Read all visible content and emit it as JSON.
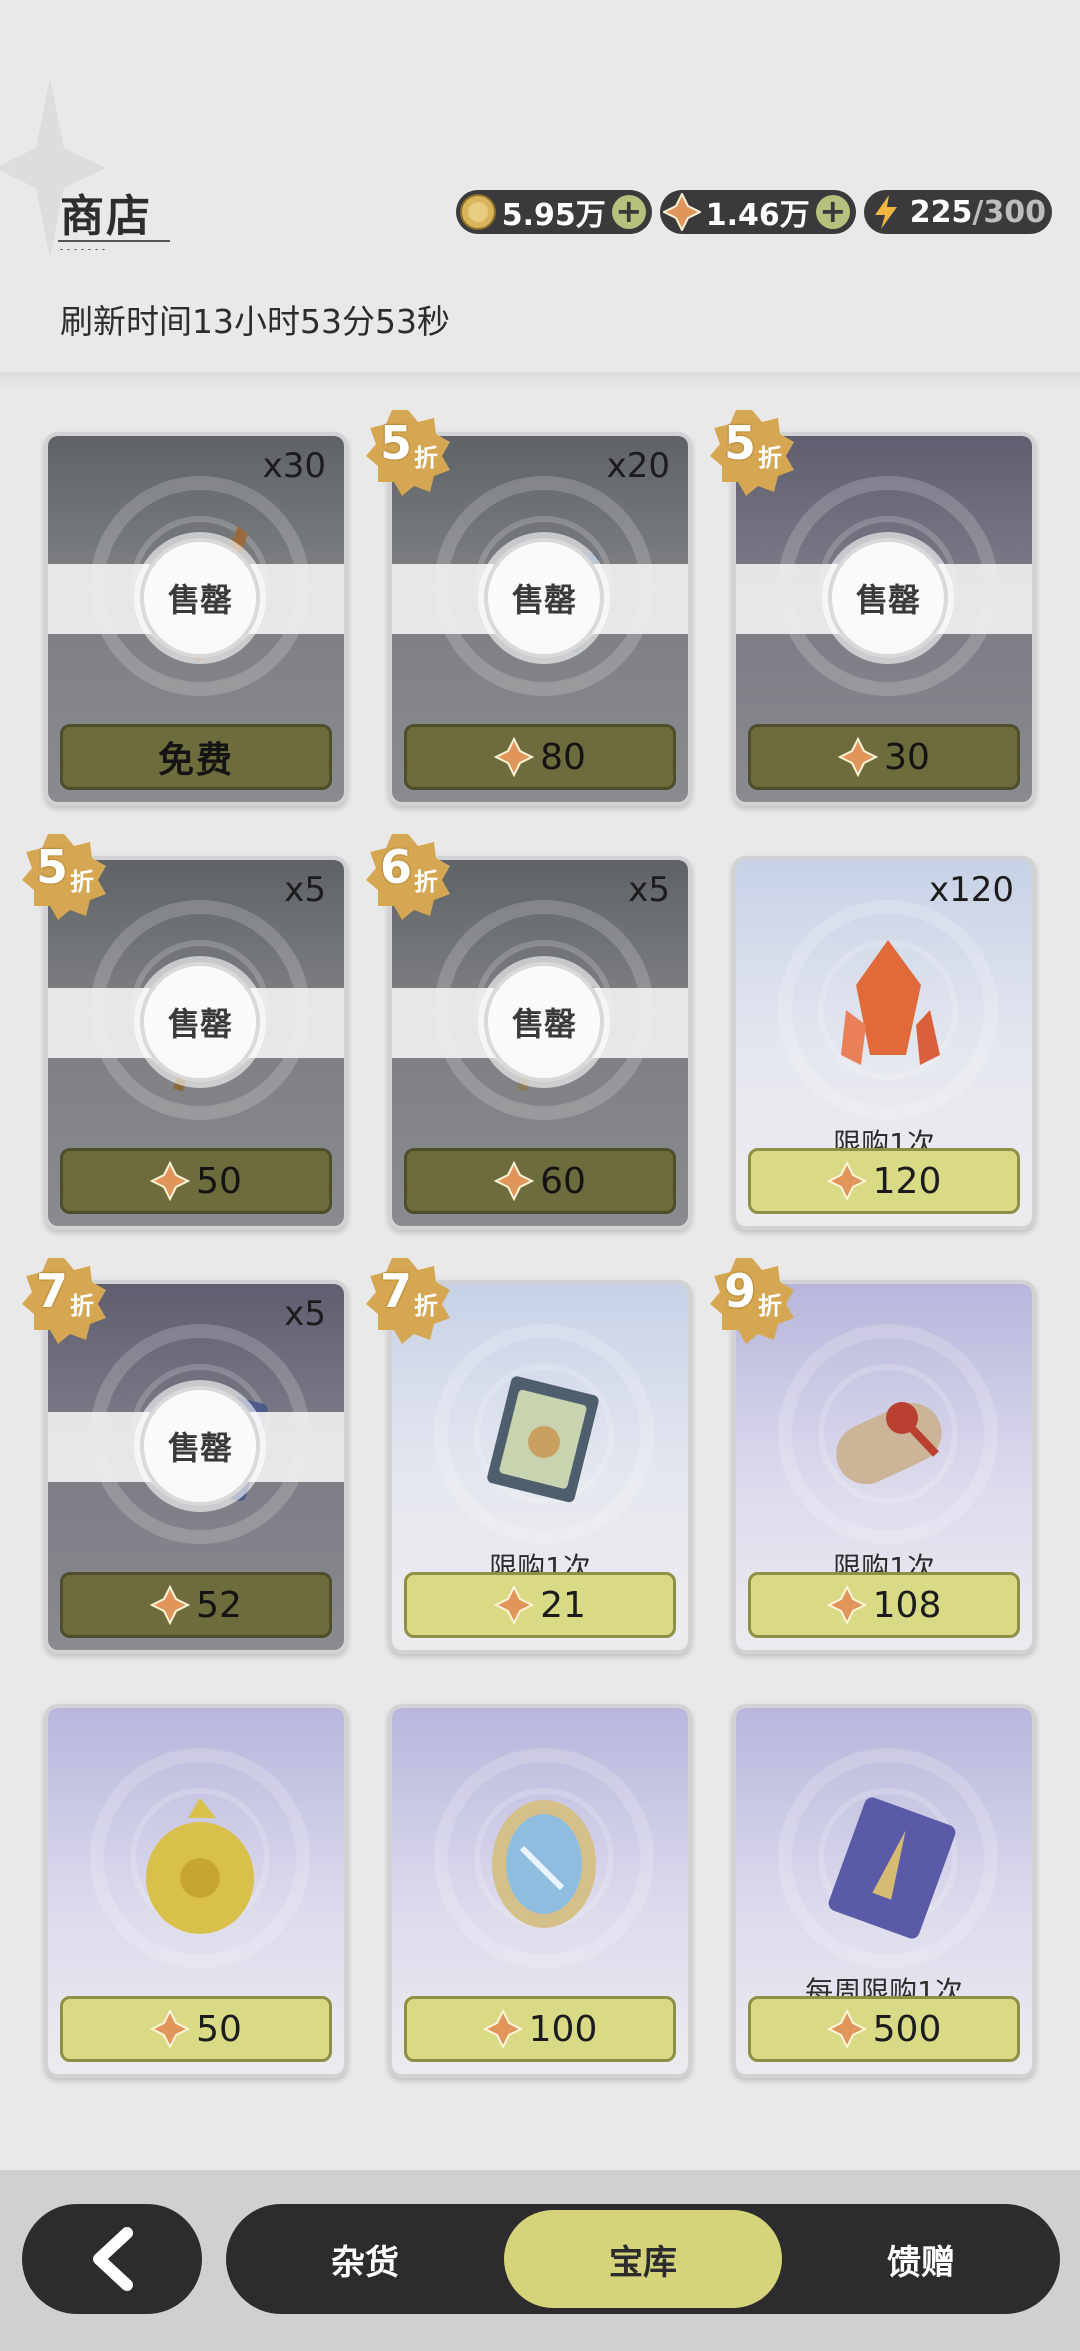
{
  "header": {
    "title": "商店",
    "refresh_text": "刷新时间13小时53分53秒"
  },
  "currencies": [
    {
      "icon": "gold-coin-icon",
      "value": "5.95万",
      "has_plus": true
    },
    {
      "icon": "crystal-icon",
      "value": "1.46万",
      "has_plus": true
    },
    {
      "icon": "lightning-icon",
      "value": "225",
      "max": "/300",
      "has_plus": false
    }
  ],
  "sold_label": "售罄",
  "discount_suffix": "折",
  "items": [
    {
      "state": "sold",
      "tone": "gray",
      "qty": "x30",
      "discount": "",
      "price": "免费",
      "free": true,
      "limit": "",
      "art": "dagger-icon"
    },
    {
      "state": "sold",
      "tone": "gray",
      "qty": "x20",
      "discount": "5",
      "price": "80",
      "free": false,
      "limit": "",
      "art": "book-icon"
    },
    {
      "state": "sold",
      "tone": "purple",
      "qty": "",
      "discount": "5",
      "price": "30",
      "free": false,
      "limit": "",
      "art": "bag-icon"
    },
    {
      "state": "sold",
      "tone": "gray",
      "qty": "x5",
      "discount": "5",
      "price": "50",
      "free": false,
      "limit": "",
      "art": "axe-icon"
    },
    {
      "state": "sold",
      "tone": "gray",
      "qty": "x5",
      "discount": "6",
      "price": "60",
      "free": false,
      "limit": "",
      "art": "pickaxe-icon"
    },
    {
      "state": "avail",
      "tone": "blue",
      "qty": "x120",
      "discount": "",
      "price": "120",
      "free": false,
      "limit": "限购1次",
      "art": "red-crystal-icon"
    },
    {
      "state": "sold",
      "tone": "purple",
      "qty": "x5",
      "discount": "7",
      "price": "52",
      "free": false,
      "limit": "",
      "art": "card-icon"
    },
    {
      "state": "avail",
      "tone": "blue",
      "qty": "",
      "discount": "7",
      "price": "21",
      "free": false,
      "limit": "限购1次",
      "art": "recipe-book-icon"
    },
    {
      "state": "avail",
      "tone": "purple",
      "qty": "",
      "discount": "9",
      "price": "108",
      "free": false,
      "limit": "限购1次",
      "art": "scroll-icon"
    },
    {
      "state": "avail",
      "tone": "purple",
      "qty": "",
      "discount": "",
      "price": "50",
      "free": false,
      "limit": "",
      "art": "golden-pot-icon"
    },
    {
      "state": "avail",
      "tone": "purple",
      "qty": "",
      "discount": "",
      "price": "100",
      "free": false,
      "limit": "",
      "art": "mirror-icon"
    },
    {
      "state": "avail",
      "tone": "purple",
      "qty": "",
      "discount": "",
      "price": "500",
      "free": false,
      "limit": "每周限购1次",
      "art": "purple-card-icon"
    }
  ],
  "nav": {
    "back_icon": "chevron-left-icon",
    "tabs": [
      "杂货",
      "宝库",
      "馈赠"
    ],
    "active_index": 1
  },
  "colors": {
    "background": "#e9e9ea",
    "price_available": "#d9da86",
    "price_sold": "#6d6c3c",
    "nav_dark": "#2c2c2e",
    "tab_active": "#d5d47a"
  }
}
